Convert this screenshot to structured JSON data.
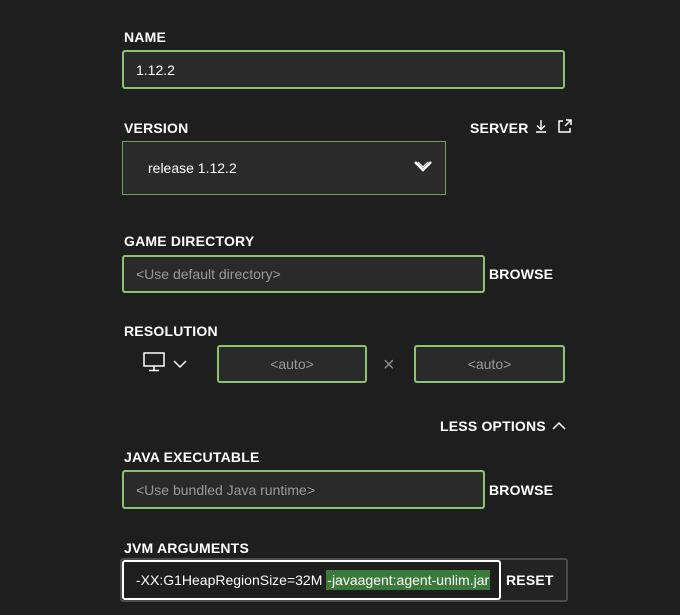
{
  "name": {
    "label": "NAME",
    "value": "1.12.2"
  },
  "version": {
    "label": "VERSION",
    "selected": "release 1.12.2",
    "server_label": "SERVER"
  },
  "game_directory": {
    "label": "GAME DIRECTORY",
    "placeholder": "<Use default directory>",
    "browse_label": "BROWSE"
  },
  "resolution": {
    "label": "RESOLUTION",
    "width_placeholder": "<auto>",
    "height_placeholder": "<auto>",
    "separator": "×"
  },
  "options_toggle": {
    "label": "LESS OPTIONS"
  },
  "java_executable": {
    "label": "JAVA EXECUTABLE",
    "placeholder": "<Use bundled Java runtime>",
    "browse_label": "BROWSE"
  },
  "jvm_arguments": {
    "label": "JVM ARGUMENTS",
    "value_before": "-XX:G1HeapRegionSize=32M ",
    "value_selected": "-javaagent:agent-unlim.jar",
    "reset_label": "RESET"
  },
  "colors": {
    "background": "#1e1e1e",
    "field_bg": "#2a2a2a",
    "accent_green": "#8bc470",
    "selection_green": "#3a7a3a"
  }
}
